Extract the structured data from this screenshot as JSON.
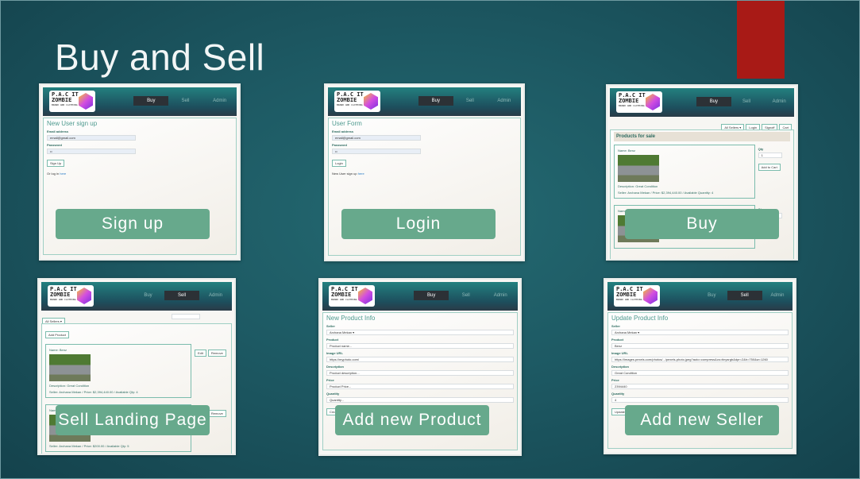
{
  "slide": {
    "title": "Buy and Sell",
    "accent": "#a81a16",
    "caption_color": "#67a98c"
  },
  "logo": {
    "line1": "P.A.C IT",
    "line2": "ZOMBIE",
    "tag": "BRAND AND CLOTHING"
  },
  "nav": [
    "Buy",
    "Sell",
    "Admin"
  ],
  "thumbs": [
    {
      "caption": "Sign up",
      "active": 0,
      "items": [
        {
          "t": "h",
          "v": "New User sign up"
        },
        {
          "t": "lbl",
          "v": "Email address"
        },
        {
          "t": "in",
          "v": "email@gmail.com"
        },
        {
          "t": "lbl",
          "v": "Password"
        },
        {
          "t": "in",
          "v": "••"
        },
        {
          "t": "btn",
          "v": "Sign Up"
        },
        {
          "t": "lnk",
          "v": "Or log in ",
          "l": "here"
        }
      ]
    },
    {
      "caption": "Login",
      "active": 0,
      "items": [
        {
          "t": "h",
          "v": "User Form"
        },
        {
          "t": "lbl",
          "v": "Email address"
        },
        {
          "t": "in",
          "v": "email@gmail.com"
        },
        {
          "t": "lbl",
          "v": "Password"
        },
        {
          "t": "in",
          "v": "••"
        },
        {
          "t": "btn",
          "v": "Login"
        },
        {
          "t": "lnk",
          "v": "New User sign up ",
          "l": "here"
        }
      ]
    },
    {
      "caption": "Buy",
      "active": 0,
      "toolbar": [
        "All Sellers ▾",
        "Login",
        "Signoff",
        "Cart"
      ],
      "items": [
        {
          "t": "bar",
          "v": "Products for sale"
        },
        {
          "t": "prod",
          "name": "Name: Benz",
          "desc": "Description: Great Condition",
          "meta": "Seller: Archana Mekan / Price: $2,394,440.00 / Available Quantity: 4",
          "side": [
            "Qty",
            "1",
            "Add to Cart"
          ]
        },
        {
          "t": "prod",
          "name": "Name: Laptop",
          "desc": "",
          "meta": "",
          "side": [
            "Qty",
            "1"
          ]
        }
      ]
    },
    {
      "caption": "Sell Landing  Page",
      "active": 1,
      "toolbar": [
        "All Sellers ▾"
      ],
      "items": [
        {
          "t": "btn",
          "v": "Add Product"
        },
        {
          "t": "prod",
          "name": "Name: Benz",
          "desc": "Description: Great Condition",
          "meta": "Seller: Archana Mekan / Price: $2,394,440.00 / Available Qty: 4",
          "side": [
            "Edit",
            "Remove"
          ]
        },
        {
          "t": "prod",
          "name": "Name: Laptop",
          "desc": "",
          "meta": "Seller: Archana Mekan / Price: $200.00 / Available Qty: 5",
          "side": [
            "Edit",
            "Remove"
          ]
        }
      ]
    },
    {
      "caption": "Add new Product",
      "active": 0,
      "items": [
        {
          "t": "h",
          "v": "New Product Info"
        },
        {
          "t": "lbl",
          "v": "Seller"
        },
        {
          "t": "in",
          "v": "Archana Mekan ▾"
        },
        {
          "t": "lbl",
          "v": "Product"
        },
        {
          "t": "in",
          "v": "Product name..."
        },
        {
          "t": "lbl",
          "v": "Image URL"
        },
        {
          "t": "in",
          "v": "https://myphoto.com/"
        },
        {
          "t": "lbl",
          "v": "Description"
        },
        {
          "t": "in",
          "v": "Product description..."
        },
        {
          "t": "lbl",
          "v": "Price"
        },
        {
          "t": "in",
          "v": "Product Price..."
        },
        {
          "t": "lbl",
          "v": "Quantity"
        },
        {
          "t": "in",
          "v": "Quantity..."
        },
        {
          "t": "btn",
          "v": "Create"
        }
      ]
    },
    {
      "caption": "Add new Seller",
      "active": 1,
      "items": [
        {
          "t": "h",
          "v": "Update Product Info"
        },
        {
          "t": "lbl",
          "v": "Seller"
        },
        {
          "t": "in",
          "v": "Archana Mekan ▾"
        },
        {
          "t": "lbl",
          "v": "Product"
        },
        {
          "t": "in",
          "v": "Benz"
        },
        {
          "t": "lbl",
          "v": "Image URL"
        },
        {
          "t": "in",
          "v": "https://images.pexels.com/photos/.../pexels-photo.jpeg?auto=compress&cs=tinysrgb&dpr=2&h=750&w=1260"
        },
        {
          "t": "lbl",
          "v": "Description"
        },
        {
          "t": "in",
          "v": "Great Condition"
        },
        {
          "t": "lbl",
          "v": "Price"
        },
        {
          "t": "in",
          "v": "2394440"
        },
        {
          "t": "lbl",
          "v": "Quantity"
        },
        {
          "t": "in",
          "v": "4"
        },
        {
          "t": "btn",
          "v": "Update"
        }
      ]
    }
  ]
}
